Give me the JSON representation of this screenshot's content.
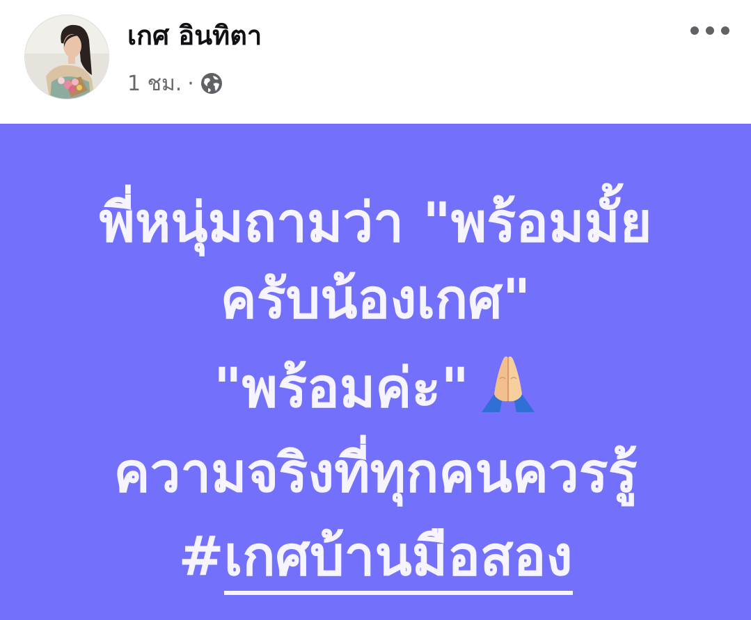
{
  "author": {
    "name": "เกศ อินทิตา",
    "avatar_alt": "profile picture"
  },
  "meta": {
    "time": "1 ชม.",
    "separator": "·",
    "audience_icon": "globe-icon"
  },
  "header": {
    "more_icon": "more-options-icon"
  },
  "post": {
    "background_color": "#7371fc",
    "text_color": "#f6f4ff",
    "line1": "พี่หนุ่มถามว่า \"พร้อมมั้ย",
    "line2": "ครับน้องเกศ\"",
    "line3": "\"พร้อมค่ะ\"",
    "line3_emoji": "folded-hands-icon",
    "line4": "ความจริงที่ทุกคนควรรู้",
    "hashtag_prefix": "#",
    "hashtag_text": "เกศบ้านมือสอง"
  }
}
